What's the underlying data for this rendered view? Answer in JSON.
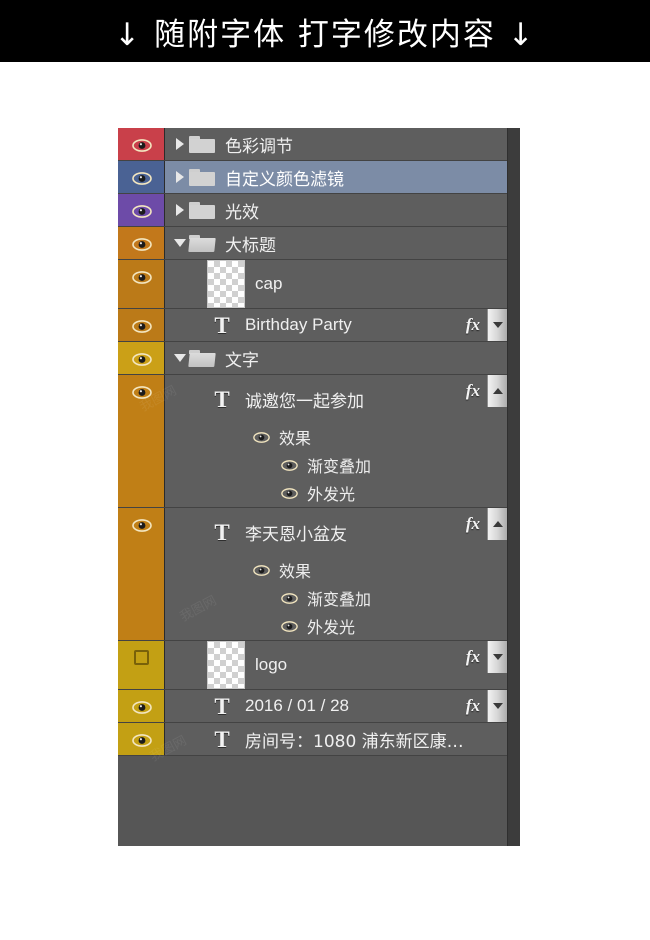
{
  "banner": {
    "text": "↓ 随附字体 打字修改内容 ↓",
    "background": "#000000",
    "color": "#ffffff"
  },
  "panel": {
    "background": "#565656",
    "row_background": "#5e5e5e",
    "selected_background": "#7c8ca6",
    "text_color": "#f0f0f0",
    "layers": [
      {
        "name": "色彩调节",
        "kind": "group",
        "expanded": false,
        "visible": true,
        "selected": false,
        "swatch": "#c9404a",
        "has_fx": false
      },
      {
        "name": "自定义颜色滤镜",
        "kind": "group",
        "expanded": false,
        "visible": true,
        "selected": true,
        "swatch": "#4a6294",
        "has_fx": false
      },
      {
        "name": "光效",
        "kind": "group",
        "expanded": false,
        "visible": true,
        "selected": false,
        "swatch": "#6d4ba8",
        "has_fx": false
      },
      {
        "name": "大标题",
        "kind": "group",
        "expanded": true,
        "visible": true,
        "selected": false,
        "swatch": "#c2781b",
        "has_fx": false
      },
      {
        "name": "cap",
        "kind": "image",
        "visible": true,
        "selected": false,
        "swatch": "#bb7a18",
        "has_fx": false
      },
      {
        "name": "Birthday Party",
        "kind": "text",
        "visible": true,
        "selected": false,
        "swatch": "#bb7a18",
        "has_fx": true,
        "fx_label": "fx",
        "fx_expander": "chevron-down"
      },
      {
        "name": "文字",
        "kind": "group",
        "expanded": true,
        "visible": true,
        "selected": false,
        "swatch": "#cba017",
        "has_fx": false
      },
      {
        "name": "诚邀您一起参加",
        "kind": "text",
        "visible": true,
        "selected": false,
        "swatch": "#c07f16",
        "has_fx": true,
        "fx_label": "fx",
        "fx_expander": "chevron-up",
        "effects": {
          "title": "效果",
          "items": [
            "渐变叠加",
            "外发光"
          ]
        }
      },
      {
        "name": "李天恩小盆友",
        "kind": "text",
        "visible": true,
        "selected": false,
        "swatch": "#c07f16",
        "has_fx": true,
        "fx_label": "fx",
        "fx_expander": "chevron-up",
        "effects": {
          "title": "效果",
          "items": [
            "渐变叠加",
            "外发光"
          ]
        }
      },
      {
        "name": "logo",
        "kind": "image",
        "visible": false,
        "selected": false,
        "swatch": "#c3a014",
        "has_fx": true,
        "fx_label": "fx",
        "fx_expander": "chevron-down"
      },
      {
        "name": "2016 / 01 / 28",
        "kind": "text",
        "visible": true,
        "selected": false,
        "swatch": "#c3a014",
        "has_fx": true,
        "fx_label": "fx",
        "fx_expander": "chevron-down"
      },
      {
        "name": "房间号：1080 浦东新区康…",
        "kind": "text",
        "visible": true,
        "selected": false,
        "swatch": "#c3a014",
        "has_fx": false
      }
    ]
  }
}
